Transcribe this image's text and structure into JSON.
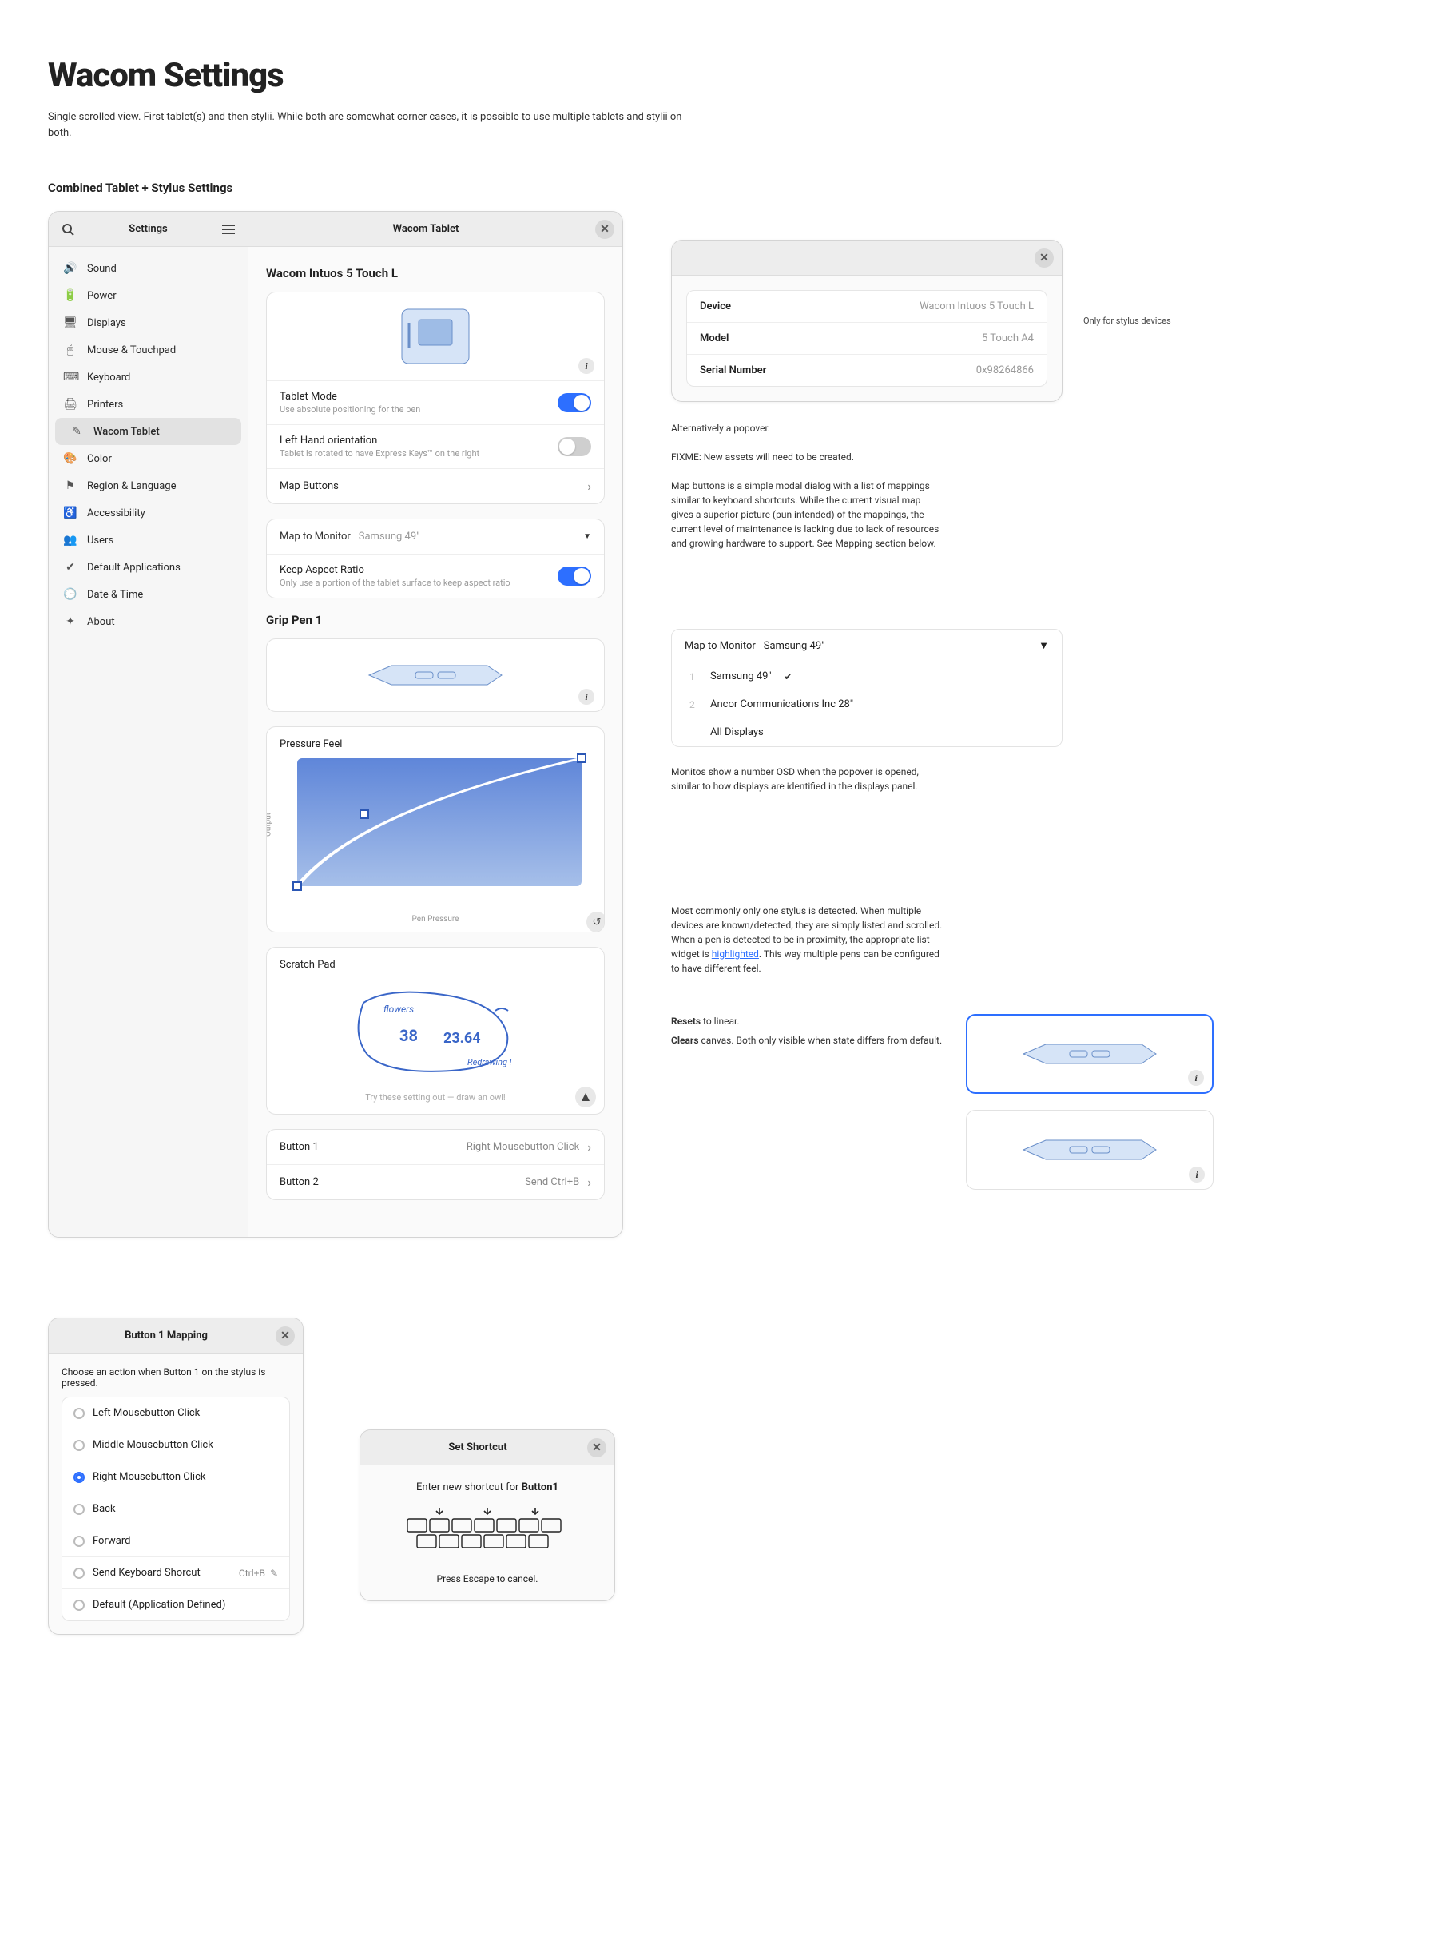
{
  "page": {
    "title": "Wacom Settings",
    "intro": "Single scrolled view. First tablet(s) and then stylii. While both are somewhat corner cases, it is possible to use multiple tablets and stylii on both.",
    "section_heading": "Combined Tablet + Stylus Settings"
  },
  "settings_window": {
    "sidebar_title": "Settings",
    "content_title": "Wacom Tablet",
    "sidebar_items": [
      {
        "icon": "🔊",
        "label": "Sound"
      },
      {
        "icon": "🔋",
        "label": "Power"
      },
      {
        "icon": "🖥",
        "label": "Displays"
      },
      {
        "icon": "🖱",
        "label": "Mouse & Touchpad"
      },
      {
        "icon": "⌨",
        "label": "Keyboard"
      },
      {
        "icon": "🖨",
        "label": "Printers"
      },
      {
        "icon": "✎",
        "label": "Wacom Tablet"
      },
      {
        "icon": "🎨",
        "label": "Color"
      },
      {
        "icon": "⚑",
        "label": "Region & Language"
      },
      {
        "icon": "♿",
        "label": "Accessibility"
      },
      {
        "icon": "👥",
        "label": "Users"
      },
      {
        "icon": "✔",
        "label": "Default Applications"
      },
      {
        "icon": "🕒",
        "label": "Date & Time"
      },
      {
        "icon": "✦",
        "label": "About"
      }
    ]
  },
  "tablet": {
    "name": "Wacom Intuos 5 Touch L",
    "tablet_mode": {
      "title": "Tablet Mode",
      "sub": "Use absolute positioning for the pen",
      "on": true
    },
    "left_hand": {
      "title": "Left Hand orientation",
      "sub": "Tablet is rotated to have Express Keys™ on the right",
      "on": false
    },
    "map_buttons": {
      "title": "Map Buttons"
    },
    "map_monitor": {
      "label": "Map to Monitor",
      "value": "Samsung 49\""
    },
    "keep_aspect": {
      "title": "Keep Aspect Ratio",
      "sub": "Only use a portion of the tablet surface to keep aspect ratio",
      "on": true
    }
  },
  "pen": {
    "name": "Grip Pen 1",
    "pressure_label": "Pressure Feel",
    "y_axis": "Output",
    "x_axis": "Pen Pressure",
    "scratch_label": "Scratch Pad",
    "scratch_hint": "Try these setting out — draw an owl!",
    "buttons": [
      {
        "label": "Button 1",
        "value": "Right Mousebutton Click"
      },
      {
        "label": "Button 2",
        "value": "Send Ctrl+B"
      }
    ]
  },
  "device_info": {
    "device_k": "Device",
    "device_v": "Wacom Intuos 5 Touch L",
    "model_k": "Model",
    "model_v": "5 Touch A4",
    "serial_k": "Serial Number",
    "serial_v": "0x98264866",
    "serial_note": "Only for stylus devices"
  },
  "annotations": {
    "alt_popover": "Alternatively a popover.",
    "fixme": "FIXME: New assets will need to be created.",
    "map_buttons_note": "Map buttons is a simple modal dialog with a list of mappings similar to keyboard shortcuts. While the current visual map gives a superior picture (pun intended) of the mappings, the current level of maintenance is lacking due to lack of resources and growing hardware to support. See Mapping section below.",
    "monitor_osd": "Monitos show a number OSD when the popover is opened, similar to how displays are identified in the displays panel.",
    "multi_stylus": "Most commonly only one stylus is detected. When multiple devices are known/detected, they are simply listed and scrolled. When a pen is detected to be in proximity, the appropriate list widget is highlighted. This way multiple pens can be configured to have different feel.",
    "resets": "Resets to linear.",
    "clears": "Clears canvas. Both only visible when state differs from default."
  },
  "map_popover": {
    "label": "Map to Monitor",
    "value": "Samsung 49\"",
    "options": [
      {
        "num": "1",
        "label": "Samsung 49\"",
        "checked": true
      },
      {
        "num": "2",
        "label": "Ancor Communications Inc 28\"",
        "checked": false
      },
      {
        "num": "",
        "label": "All Displays",
        "checked": false
      }
    ]
  },
  "mapping_modal": {
    "title": "Button 1 Mapping",
    "prompt": "Choose an action when Button 1 on the stylus is pressed.",
    "options": [
      {
        "label": "Left Mousebutton Click",
        "checked": false
      },
      {
        "label": "Middle Mousebutton Click",
        "checked": false
      },
      {
        "label": "Right Mousebutton Click",
        "checked": true
      },
      {
        "label": "Back",
        "checked": false
      },
      {
        "label": "Forward",
        "checked": false
      },
      {
        "label": "Send Keyboard Shorcut",
        "checked": false,
        "trail": "Ctrl+B"
      },
      {
        "label": "Default (Application Defined)",
        "checked": false
      }
    ]
  },
  "shortcut_modal": {
    "title": "Set Shortcut",
    "prompt_prefix": "Enter new shortcut for ",
    "prompt_bold": "Button1",
    "cancel": "Press Escape to cancel."
  },
  "chart_data": {
    "type": "line",
    "title": "Pressure Feel",
    "xlabel": "Pen Pressure",
    "ylabel": "Output",
    "xlim": [
      0,
      1
    ],
    "ylim": [
      0,
      1
    ],
    "series": [
      {
        "name": "response-curve",
        "x": [
          0,
          0.1,
          0.2,
          0.3,
          0.4,
          0.5,
          0.6,
          0.7,
          0.8,
          0.9,
          1.0
        ],
        "y": [
          0,
          0.28,
          0.45,
          0.58,
          0.68,
          0.76,
          0.83,
          0.89,
          0.93,
          0.97,
          1.0
        ]
      }
    ],
    "control_points": {
      "start": [
        0,
        0
      ],
      "end": [
        1,
        1
      ],
      "handle": [
        0.22,
        0.6
      ]
    }
  }
}
